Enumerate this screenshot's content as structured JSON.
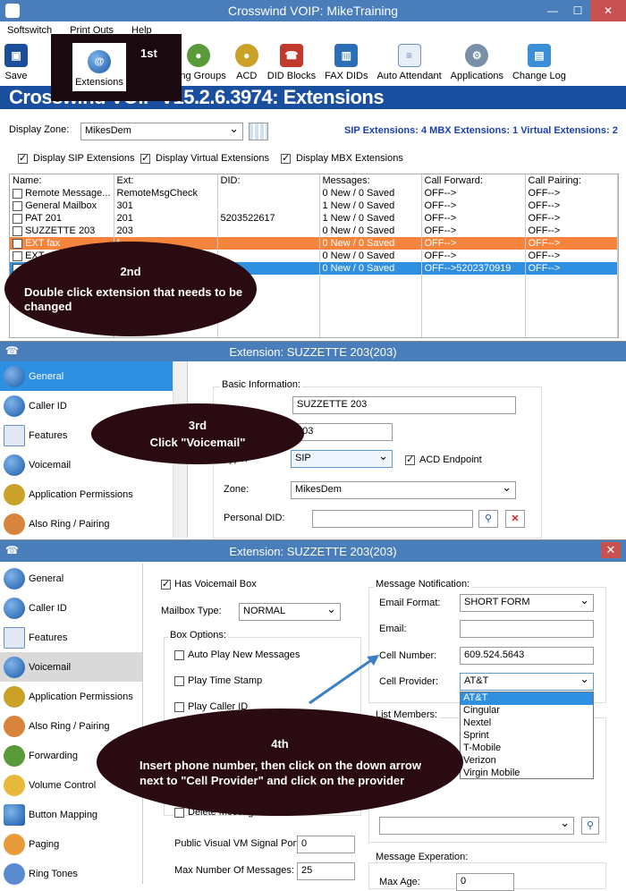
{
  "window1": {
    "title": "Crosswind VOIP: MikeTraining",
    "menu": [
      "Softswitch",
      "Print Outs",
      "Help"
    ],
    "toolbar": [
      "Save",
      "Extensions",
      "Ring Groups",
      "ACD",
      "DID Blocks",
      "FAX DIDs",
      "Auto Attendant",
      "Applications",
      "Change Log"
    ],
    "banner": "Crosswind VOIP V15.2.6.3974: Extensions",
    "display_zone_label": "Display Zone:",
    "display_zone_value": "MikesDem",
    "summary": "SIP Extensions: 4   MBX Extensions: 1   Virtual Extensions: 2",
    "checkboxes": [
      "Display SIP Extensions",
      "Display Virtual Extensions",
      "Display MBX Extensions"
    ],
    "columns": [
      "Name:",
      "Ext:",
      "DID:",
      "Messages:",
      "Call Forward:",
      "Call Pairing:"
    ],
    "rows": [
      [
        "Remote Message...",
        "RemoteMsgCheck",
        "",
        "0 New / 0 Saved",
        "OFF-->",
        "OFF-->"
      ],
      [
        "General Mailbox",
        "301",
        "",
        "1 New / 0 Saved",
        "OFF-->",
        "OFF-->"
      ],
      [
        "PAT 201",
        "201",
        "5203522617",
        "1 New / 0 Saved",
        "OFF-->",
        "OFF-->"
      ],
      [
        "SUZZETTE 203",
        "203",
        "",
        "0 New / 0 Saved",
        "OFF-->",
        "OFF-->"
      ],
      [
        "EXT fax",
        "f",
        "",
        "0 New / 0 Saved",
        "OFF-->",
        "OFF-->"
      ],
      [
        "EXT",
        "",
        "",
        "0 New / 0 Saved",
        "OFF-->",
        "OFF-->"
      ],
      [
        "",
        "",
        "",
        "0 New / 0 Saved",
        "OFF-->5202370919",
        "OFF-->"
      ]
    ]
  },
  "callouts": {
    "first": "1st",
    "second_num": "2nd",
    "second_text": "Double click extension that needs to be changed",
    "third_num": "3rd",
    "third_text": "Click  \"Voicemail\"",
    "fourth_num": "4th",
    "fourth_text": "Insert phone number, then click on the down arrow next to \"Cell Provider\" and click on the provider"
  },
  "window2": {
    "title": "Extension: SUZZETTE 203(203)",
    "nav": [
      "General",
      "Caller ID",
      "Features",
      "Voicemail",
      "Application Permissions",
      "Also Ring / Pairing"
    ],
    "basic_info": "Basic Information:",
    "name_value": "SUZZETTE 203",
    "ext_value": "203",
    "type_label": "Type:",
    "type_value": "SIP",
    "acd_label": "ACD Endpoint",
    "zone_label": "Zone:",
    "zone_value": "MikesDem",
    "personal_did_label": "Personal DID:"
  },
  "window3": {
    "title": "Extension: SUZZETTE 203(203)",
    "nav": [
      "General",
      "Caller ID",
      "Features",
      "Voicemail",
      "Application Permissions",
      "Also Ring / Pairing",
      "Forwarding",
      "Volume Control",
      "Button Mapping",
      "Paging",
      "Ring Tones"
    ],
    "has_voicemail": "Has Voicemail Box",
    "mailbox_type_label": "Mailbox Type:",
    "mailbox_type_value": "NORMAL",
    "box_options": "Box Options:",
    "options": [
      "Auto Play New Messages",
      "Play Time Stamp",
      "Play Caller ID"
    ],
    "delete_msg": "Delete Message After Email",
    "public_vm_label": "Public Visual VM Signal Port:",
    "public_vm_value": "0",
    "max_msgs_label": "Max Number Of Messages:",
    "max_msgs_value": "25",
    "message_notification": "Message Notification:",
    "email_format_label": "Email Format:",
    "email_format_value": "SHORT FORM",
    "email_label": "Email:",
    "cell_number_label": "Cell Number:",
    "cell_number_value": "609.524.5643",
    "cell_provider_label": "Cell Provider:",
    "cell_provider_value": "AT&T",
    "providers": [
      "AT&T",
      "Cingular",
      "Nextel",
      "Sprint",
      "T-Mobile",
      "Verizon",
      "Virgin Mobile"
    ],
    "list_members": "List Members:",
    "message_expiration": "Message Experation:",
    "max_age_label": "Max Age:",
    "max_age_value": "0"
  }
}
